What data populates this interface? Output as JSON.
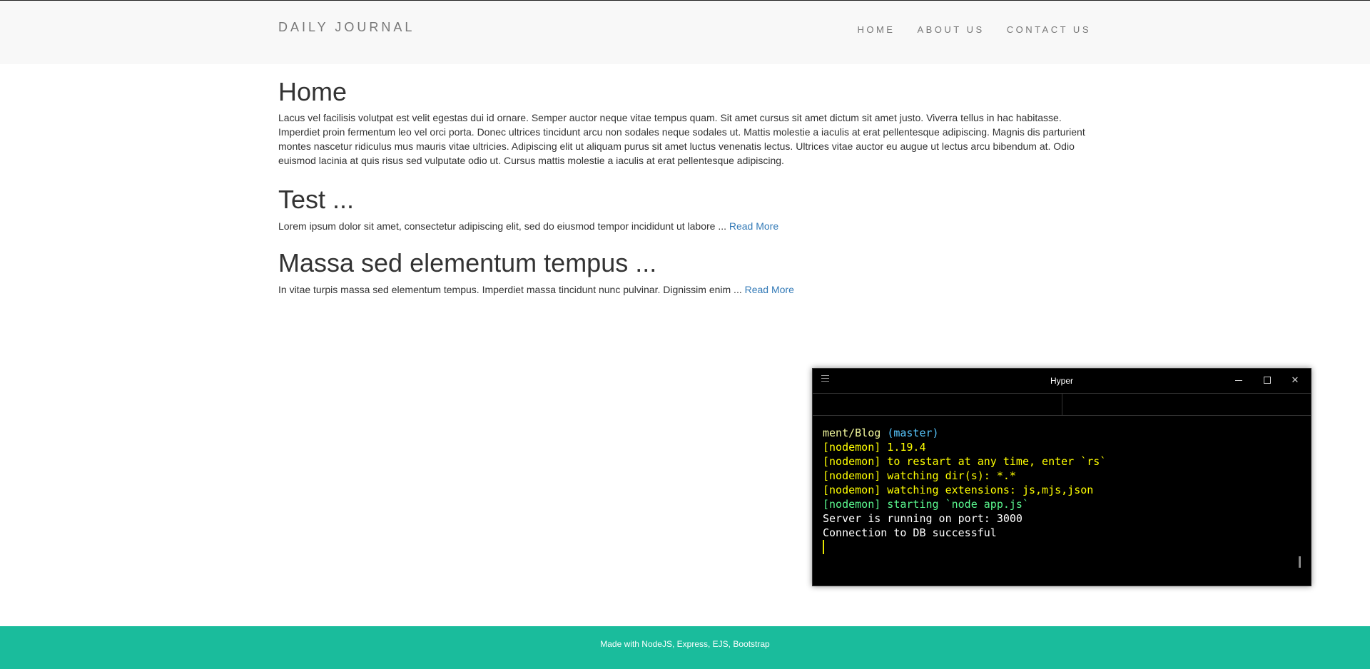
{
  "navbar": {
    "brand": "DAILY JOURNAL",
    "links": [
      "HOME",
      "ABOUT US",
      "CONTACT US"
    ]
  },
  "home": {
    "title": "Home",
    "body": "Lacus vel facilisis volutpat est velit egestas dui id ornare. Semper auctor neque vitae tempus quam. Sit amet cursus sit amet dictum sit amet justo. Viverra tellus in hac habitasse. Imperdiet proin fermentum leo vel orci porta. Donec ultrices tincidunt arcu non sodales neque sodales ut. Mattis molestie a iaculis at erat pellentesque adipiscing. Magnis dis parturient montes nascetur ridiculus mus mauris vitae ultricies. Adipiscing elit ut aliquam purus sit amet luctus venenatis lectus. Ultrices vitae auctor eu augue ut lectus arcu bibendum at. Odio euismod lacinia at quis risus sed vulputate odio ut. Cursus mattis molestie a iaculis at erat pellentesque adipiscing."
  },
  "posts": [
    {
      "title": "Test ...",
      "excerpt": "Lorem ipsum dolor sit amet, consectetur adipiscing elit, sed do eiusmod tempor incididunt ut labore ...",
      "read_more": "Read More"
    },
    {
      "title": "Massa sed elementum tempus ...",
      "excerpt": "In vitae turpis massa sed elementum tempus. Imperdiet massa tincidunt nunc pulvinar. Dignissim enim ...",
      "read_more": "Read More"
    }
  ],
  "footer": {
    "text": "Made with NodeJS, Express, EJS, Bootstrap",
    "background": "#1abc9c"
  },
  "terminal": {
    "title": "Hyper",
    "lines": [
      {
        "parts": [
          {
            "text": "ment/Blog ",
            "color": "#f3f99d"
          },
          {
            "text": "(master)",
            "color": "#57c7ff"
          }
        ]
      },
      {
        "parts": [
          {
            "text": "[nodemon] 1.19.4",
            "color": "#ffff00"
          }
        ]
      },
      {
        "parts": [
          {
            "text": "[nodemon] to restart at any time, enter `rs`",
            "color": "#ffff00"
          }
        ]
      },
      {
        "parts": [
          {
            "text": "[nodemon] watching dir(s): *.*",
            "color": "#ffff00"
          }
        ]
      },
      {
        "parts": [
          {
            "text": "[nodemon] watching extensions: js,mjs,json",
            "color": "#ffff00"
          }
        ]
      },
      {
        "parts": [
          {
            "text": "[nodemon] starting `node app.js`",
            "color": "#5af78e"
          }
        ]
      },
      {
        "parts": [
          {
            "text": "Server is running on port: 3000",
            "color": "#ffffff"
          }
        ]
      },
      {
        "parts": [
          {
            "text": "Connection to DB successful",
            "color": "#ffffff"
          }
        ]
      }
    ]
  }
}
